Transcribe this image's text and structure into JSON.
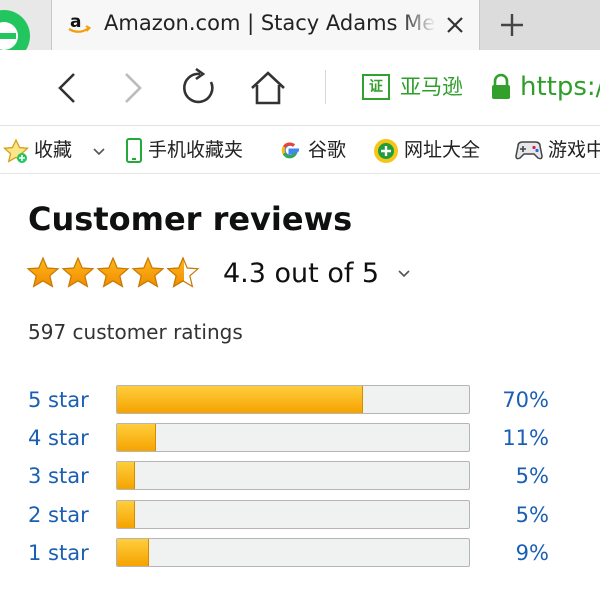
{
  "browser": {
    "tab_title": "Amazon.com | Stacy Adams Men's",
    "site_name": "亚马逊",
    "cert_label": "证",
    "url_text": "https://"
  },
  "bookmarks": [
    {
      "label": "收藏",
      "icon": "star-icon"
    },
    {
      "label": "手机收藏夹",
      "icon": "phone-icon"
    },
    {
      "label": "谷歌",
      "icon": "google-icon"
    },
    {
      "label": "网址大全",
      "icon": "plus-circle-icon"
    },
    {
      "label": "游戏中心",
      "icon": "gamepad-icon"
    }
  ],
  "reviews": {
    "title": "Customer reviews",
    "rating_text": "4.3 out of 5",
    "rating_value": 4.3,
    "total_ratings": "597 customer ratings",
    "histogram": [
      {
        "label": "5 star",
        "percent_text": "70%",
        "percent": 70
      },
      {
        "label": "4 star",
        "percent_text": "11%",
        "percent": 11
      },
      {
        "label": "3 star",
        "percent_text": "5%",
        "percent": 5
      },
      {
        "label": "2 star",
        "percent_text": "5%",
        "percent": 5
      },
      {
        "label": "1 star",
        "percent_text": "9%",
        "percent": 9
      }
    ]
  },
  "colors": {
    "link": "#1a5fb4",
    "star": "#f5a300",
    "secure_green": "#2f9e2a"
  }
}
